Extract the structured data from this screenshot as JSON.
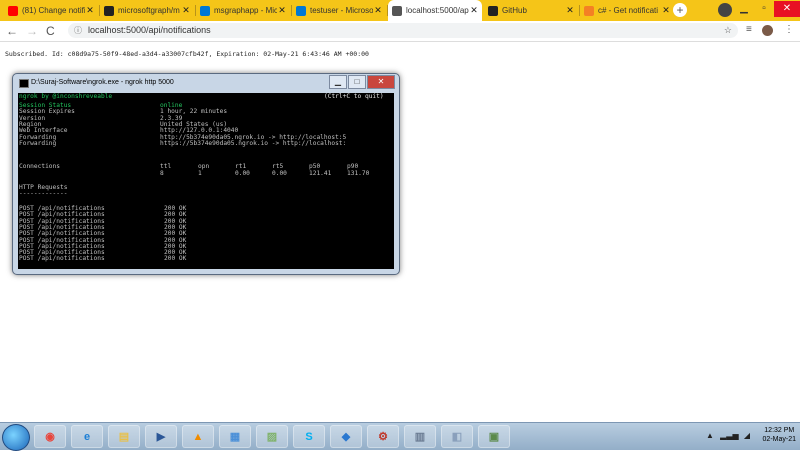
{
  "browser": {
    "tabs": [
      {
        "label": "(81) Change notific",
        "icon": "youtube-icon",
        "color": "#ff0000"
      },
      {
        "label": "microsoftgraph/m",
        "icon": "github-icon",
        "color": "#222222"
      },
      {
        "label": "msgraphapp - Mic",
        "icon": "azure-icon",
        "color": "#0078d4"
      },
      {
        "label": "testuser - Microso",
        "icon": "azure-icon",
        "color": "#0078d4"
      },
      {
        "label": "localhost:5000/ap",
        "icon": "globe-icon",
        "color": "#555555",
        "active": true
      },
      {
        "label": "GitHub",
        "icon": "github-icon",
        "color": "#222222"
      },
      {
        "label": "c# - Get notificati",
        "icon": "stackoverflow-icon",
        "color": "#f48024"
      }
    ],
    "new_tab": "+",
    "url": "localhost:5000/api/notifications"
  },
  "page": {
    "body_text": "Subscribed. Id: c08d9a75-50f9-48ed-a3d4-a33007cfb42f, Expiration: 02-May-21 6:43:46 AM +00:00"
  },
  "console": {
    "title": "D:\\Suraj-Software\\ngrok.exe - ngrok  http 5000",
    "header_left": "ngrok by @inconshreveable",
    "header_right": "(Ctrl+C to quit)",
    "info": [
      {
        "key": "Session Status",
        "value": "online",
        "green": true
      },
      {
        "key": "Session Expires",
        "value": "1 hour, 22 minutes"
      },
      {
        "key": "Version",
        "value": "2.3.39"
      },
      {
        "key": "Region",
        "value": "United States (us)"
      },
      {
        "key": "Web Interface",
        "value": "http://127.0.0.1:4040"
      },
      {
        "key": "Forwarding",
        "value": "http://5b374e90da05.ngrok.io -> http://localhost:5"
      },
      {
        "key": "Forwarding",
        "value": "https://5b374e90da05.ngrok.io -> http://localhost:"
      }
    ],
    "connections": {
      "label": "Connections",
      "headers": [
        "ttl",
        "opn",
        "rt1",
        "rt5",
        "p50",
        "p90"
      ],
      "values": [
        "8",
        "1",
        "0.00",
        "0.00",
        "121.41",
        "131.70"
      ]
    },
    "http_requests": {
      "label": "HTTP Requests",
      "underline": "-------------",
      "rows": [
        {
          "req": "POST /api/notifications",
          "status": "200 OK"
        },
        {
          "req": "POST /api/notifications",
          "status": "200 OK"
        },
        {
          "req": "POST /api/notifications",
          "status": "200 OK"
        },
        {
          "req": "POST /api/notifications",
          "status": "200 OK"
        },
        {
          "req": "POST /api/notifications",
          "status": "200 OK"
        },
        {
          "req": "POST /api/notifications",
          "status": "200 OK"
        },
        {
          "req": "POST /api/notifications",
          "status": "200 OK"
        },
        {
          "req": "POST /api/notifications",
          "status": "200 OK"
        },
        {
          "req": "POST /api/notifications",
          "status": "200 OK"
        }
      ]
    }
  },
  "taskbar": {
    "items": [
      "chrome-icon",
      "ie-icon",
      "explorer-icon",
      "media-player-icon",
      "vlc-icon",
      "control-panel-icon",
      "folder-icon",
      "skype-icon",
      "vscode-icon",
      "tool-icon",
      "network-icon",
      "app-icon",
      "terminal-icon"
    ],
    "time": "12:32 PM",
    "date": "02-May-21"
  }
}
